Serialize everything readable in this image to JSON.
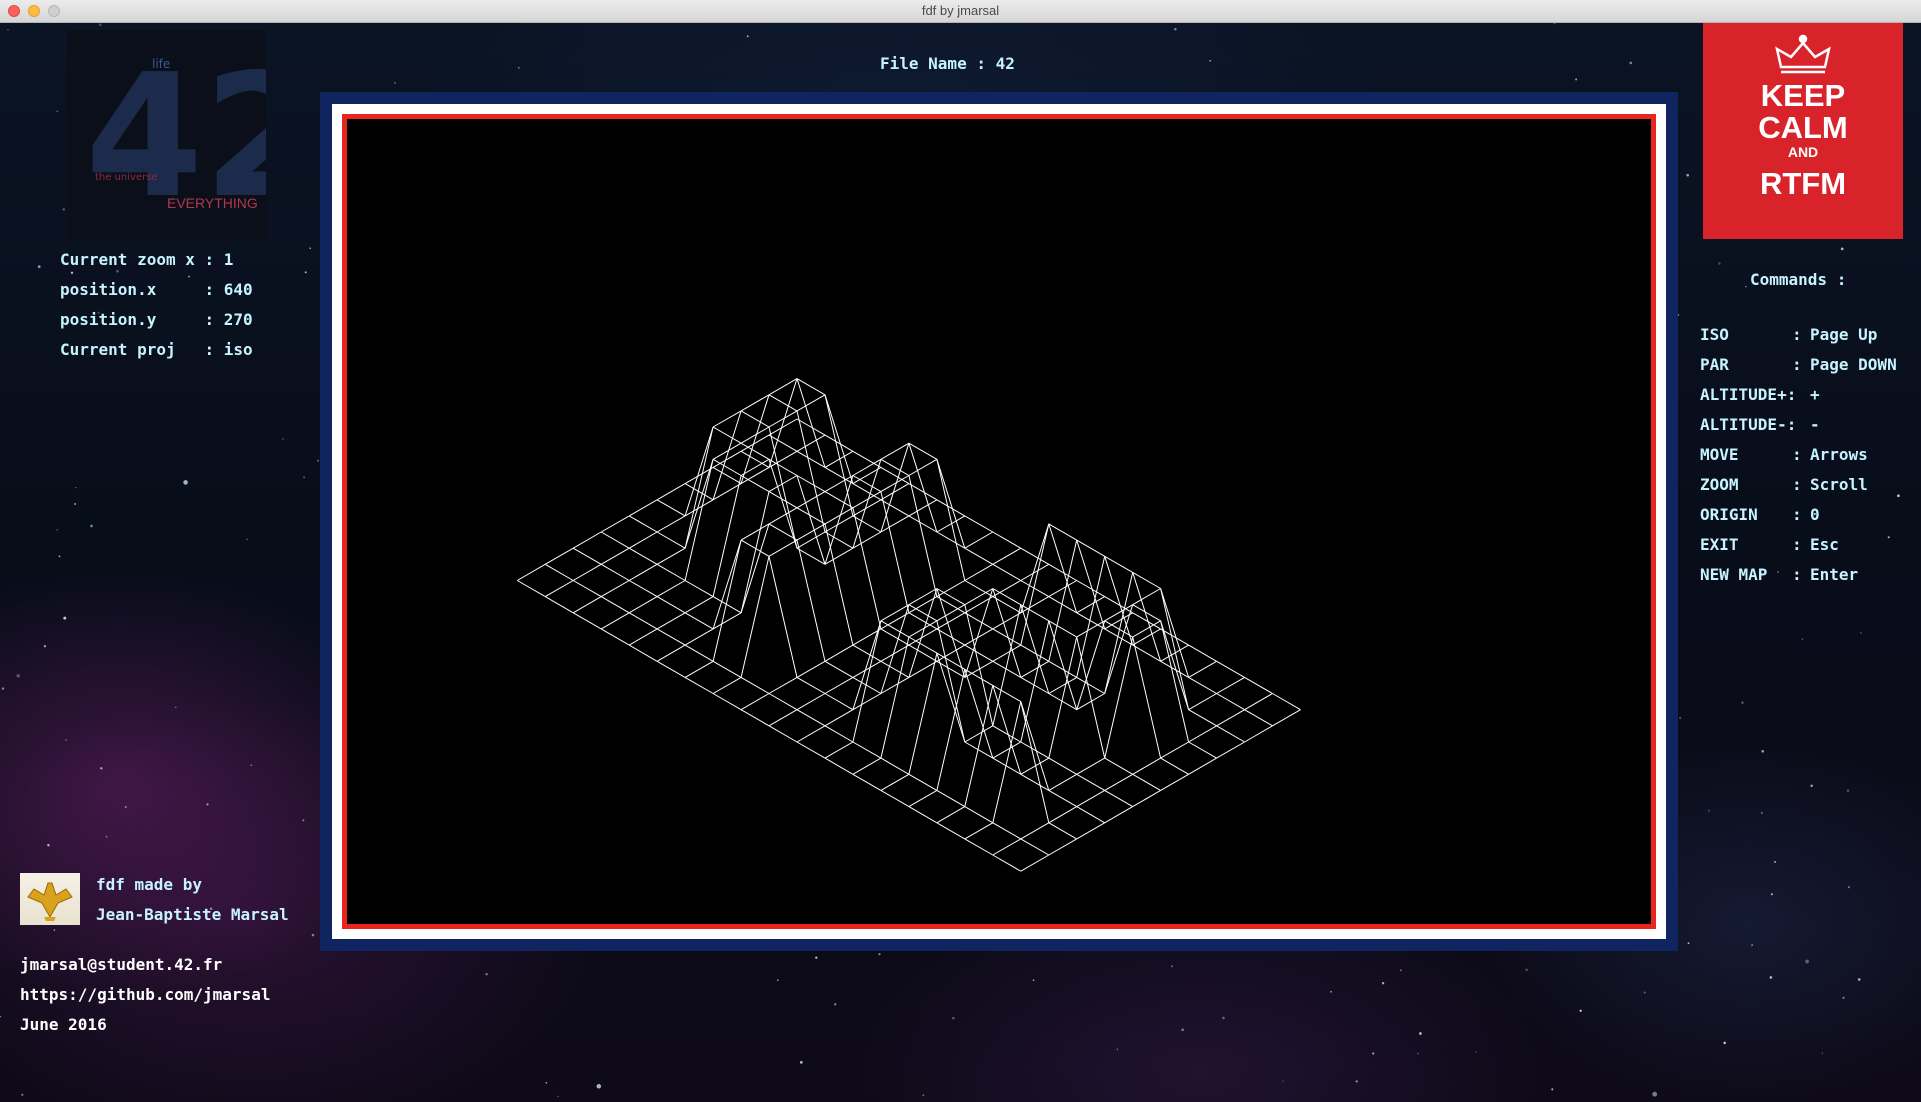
{
  "window": {
    "title": "fdf by jmarsal"
  },
  "status": {
    "zoom_label": "Current zoom x :",
    "zoom_value": "1",
    "posx_label": "position.x     :",
    "posx_value": "640",
    "posy_label": "position.y     :",
    "posy_value": "270",
    "proj_label": "Current proj   :",
    "proj_value": "iso"
  },
  "logo42": {
    "text": "42",
    "word_top": "life",
    "word_bottom": "EVERYTHING",
    "word_universe": "the universe"
  },
  "file": {
    "label": "File Name : 42"
  },
  "keepcalm": {
    "line1": "KEEP",
    "line2": "CALM",
    "line3": "AND",
    "line4": "RTFM"
  },
  "commands": {
    "title": "Commands :",
    "items": [
      {
        "key": "ISO",
        "sep": ":",
        "value": "Page Up"
      },
      {
        "key": "PAR",
        "sep": ":",
        "value": "Page DOWN"
      },
      {
        "key": "ALTITUDE+:",
        "sep": "",
        "value": "+"
      },
      {
        "key": "ALTITUDE-:",
        "sep": "",
        "value": "-"
      },
      {
        "key": "MOVE",
        "sep": ":",
        "value": "Arrows"
      },
      {
        "key": "ZOOM",
        "sep": ":",
        "value": "Scroll"
      },
      {
        "key": "ORIGIN",
        "sep": ":",
        "value": "0"
      },
      {
        "key": "EXIT",
        "sep": ":",
        "value": "Esc"
      },
      {
        "key": "NEW MAP",
        "sep": ":",
        "value": "Enter"
      }
    ]
  },
  "credits": {
    "line1": "fdf made by",
    "line2": "Jean-Baptiste Marsal",
    "email": "jmarsal@student.42.fr",
    "github": "https://github.com/jmarsal",
    "date": "June 2016"
  },
  "colors": {
    "text": "#c6f3ff",
    "frame_outer": "#10255f",
    "frame_red": "#e8261f",
    "keepcalm_bg": "#d8232a",
    "wire": "#ffffff"
  },
  "map42": {
    "rows": [
      [
        0,
        0,
        0,
        0,
        0,
        0,
        0,
        0,
        0,
        0,
        0,
        0,
        0,
        0,
        0,
        0,
        0,
        0,
        0
      ],
      [
        0,
        0,
        0,
        0,
        0,
        0,
        0,
        0,
        0,
        0,
        0,
        0,
        0,
        0,
        0,
        0,
        0,
        0,
        0
      ],
      [
        0,
        0,
        10,
        10,
        0,
        0,
        10,
        10,
        0,
        0,
        0,
        10,
        10,
        10,
        10,
        10,
        0,
        0,
        0
      ],
      [
        0,
        0,
        10,
        10,
        0,
        0,
        10,
        10,
        0,
        0,
        0,
        0,
        0,
        0,
        0,
        10,
        10,
        0,
        0
      ],
      [
        0,
        0,
        10,
        10,
        0,
        0,
        10,
        10,
        0,
        0,
        0,
        0,
        0,
        0,
        0,
        10,
        10,
        0,
        0
      ],
      [
        0,
        0,
        10,
        10,
        10,
        10,
        10,
        10,
        0,
        0,
        0,
        0,
        10,
        10,
        10,
        10,
        0,
        0,
        0
      ],
      [
        0,
        0,
        0,
        10,
        10,
        10,
        10,
        10,
        0,
        0,
        0,
        10,
        10,
        0,
        0,
        0,
        0,
        0,
        0
      ],
      [
        0,
        0,
        0,
        0,
        0,
        0,
        10,
        10,
        0,
        0,
        0,
        10,
        10,
        0,
        0,
        0,
        0,
        0,
        0
      ],
      [
        0,
        0,
        0,
        0,
        0,
        0,
        10,
        10,
        0,
        0,
        0,
        10,
        10,
        10,
        10,
        10,
        10,
        0,
        0
      ],
      [
        0,
        0,
        0,
        0,
        0,
        0,
        0,
        0,
        0,
        0,
        0,
        0,
        0,
        0,
        0,
        0,
        0,
        0,
        0
      ],
      [
        0,
        0,
        0,
        0,
        0,
        0,
        0,
        0,
        0,
        0,
        0,
        0,
        0,
        0,
        0,
        0,
        0,
        0,
        0
      ]
    ]
  }
}
